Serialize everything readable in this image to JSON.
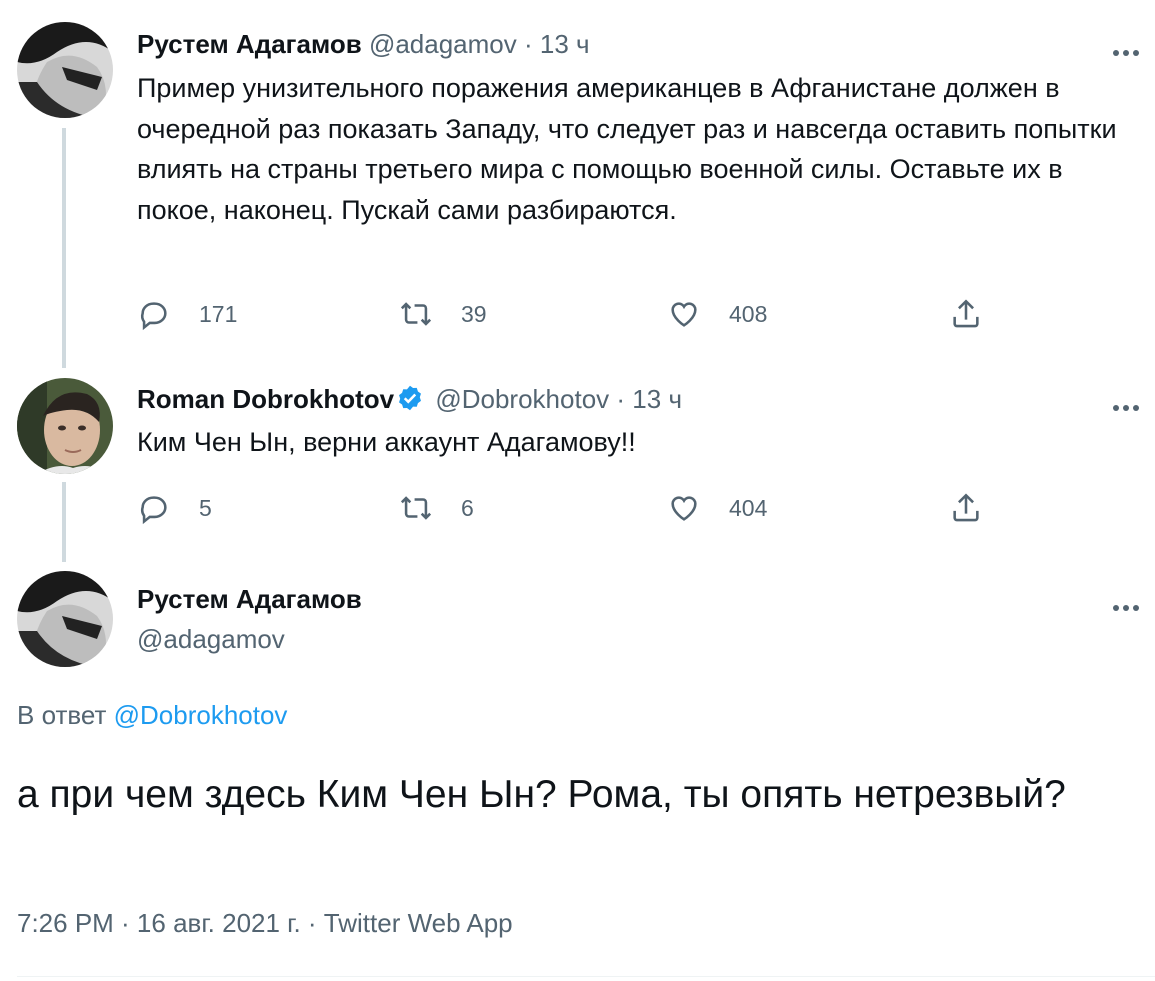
{
  "tweets": [
    {
      "name": "Рустем Адагамов",
      "handle": "@adagamov",
      "dot": "·",
      "time": "13 ч",
      "text": "Пример унизительного поражения американцев в Афганистане должен в очередной раз показать Западу, что следует раз и навсегда оставить попытки влиять на страны третьего мира с помощью военной силы. Оставьте их в покое, наконец. Пускай сами разбираются.",
      "replies": "171",
      "retweets": "39",
      "likes": "408"
    },
    {
      "name": "Roman Dobrokhotov",
      "handle": "@Dobrokhotov",
      "dot": "·",
      "time": "13 ч",
      "text": "Ким Чен Ын, верни аккаунт Адагамову!!",
      "replies": "5",
      "retweets": "6",
      "likes": "404"
    }
  ],
  "main_tweet": {
    "name": "Рустем Адагамов",
    "handle": "@adagamov",
    "reply_prefix": "В ответ",
    "reply_mention": "@Dobrokhotov",
    "text": "а при чем здесь Ким Чен Ын? Рома, ты опять нетрезвый?",
    "meta": "7:26 PM · 16 авг. 2021 г. · Twitter Web App"
  },
  "colors": {
    "text": "#0f1419",
    "secondary": "#536471",
    "accent": "#1d9bf0",
    "thread_line": "#cfd9de"
  },
  "icons": [
    "more-icon",
    "reply-icon",
    "retweet-icon",
    "like-icon",
    "share-icon",
    "verified-badge-icon"
  ]
}
